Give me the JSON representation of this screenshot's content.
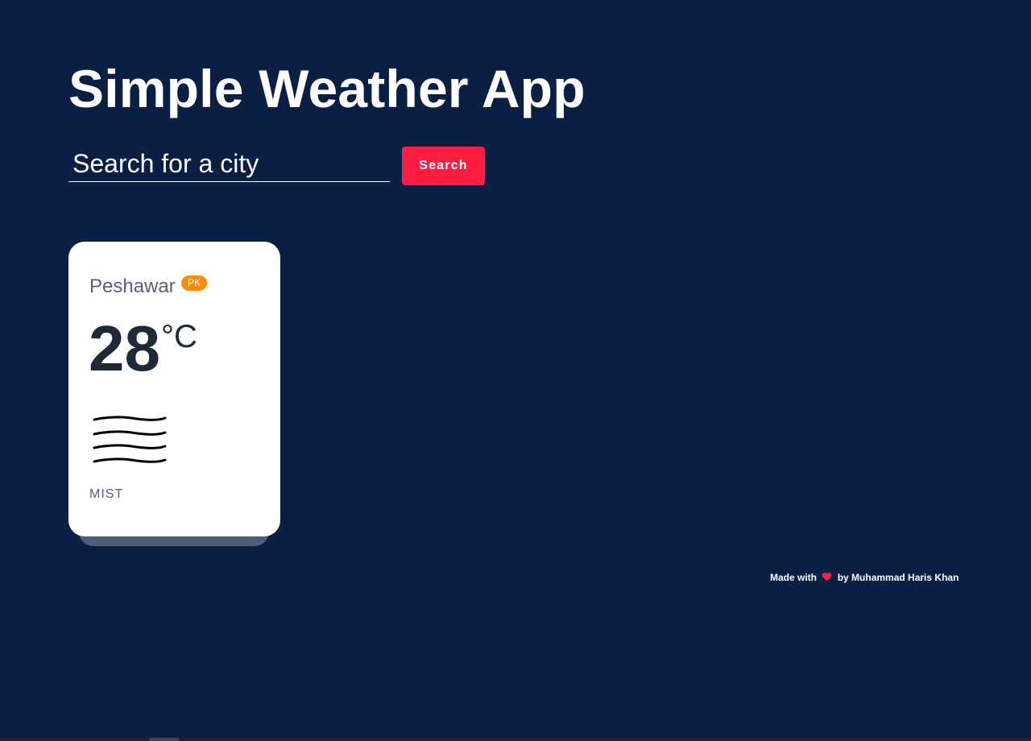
{
  "app": {
    "title": "Simple Weather App"
  },
  "search": {
    "placeholder": "Search for a city",
    "value": "",
    "button_label": "Search"
  },
  "weather_card": {
    "city": "Peshawar",
    "country_code": "PK",
    "temperature": "28",
    "unit": "°C",
    "icon": "mist-icon",
    "description": "MIST"
  },
  "footer": {
    "prefix": "Made with",
    "heart_icon": "heart-icon",
    "suffix": "by Muhammad Haris Khan"
  },
  "colors": {
    "background": "#0b1f45",
    "accent": "#ff1e42",
    "badge": "#ff8c00",
    "card": "#ffffff"
  }
}
